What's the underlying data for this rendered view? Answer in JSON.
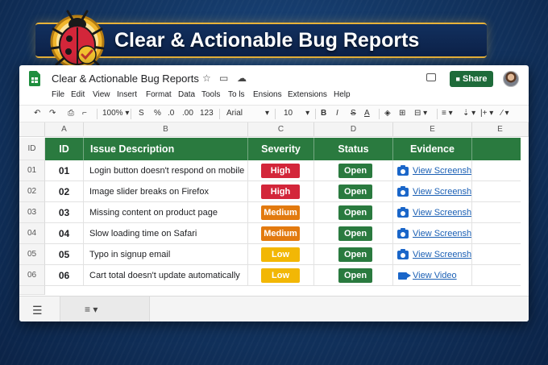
{
  "banner": {
    "title": "Clear & Actionable Bug Reports"
  },
  "app": {
    "doc_title": "Clear & Actionable Bug Reports",
    "share_label": "Share",
    "menu": [
      "File",
      "Edit",
      "View",
      "Insert",
      "Format",
      "Data",
      "Tools",
      "To ls",
      "Ensions",
      "Extensions",
      "Help"
    ],
    "toolbar": {
      "zoom": "100%",
      "currency": "S",
      "percent": "%",
      "dec_less": ".0",
      "dec_more": ".00",
      "number_format": "123",
      "font": "Arial",
      "font_size": "10",
      "bold": "B",
      "italic": "I",
      "strike": "S"
    }
  },
  "columns": [
    "A",
    "B",
    "C",
    "D",
    "E",
    "E"
  ],
  "header_row_label": "ID",
  "headers": {
    "id": "ID",
    "desc": "Issue Description",
    "severity": "Severity",
    "status": "Status",
    "evidence": "Evidence"
  },
  "rows": [
    {
      "num": "01",
      "id": "01",
      "desc": "Login button doesn't respond on mobile",
      "severity": "High",
      "status": "Open",
      "evidence": "View Screenshot",
      "evidence_icon": "camera-icon"
    },
    {
      "num": "02",
      "id": "02",
      "desc": "Image slider breaks on Firefox",
      "severity": "High",
      "status": "Open",
      "evidence": "View Screenshot",
      "evidence_icon": "camera-icon"
    },
    {
      "num": "03",
      "id": "03",
      "desc": "Missing content on product page",
      "severity": "Medium",
      "status": "Open",
      "evidence": "View Screenshot",
      "evidence_icon": "camera-icon"
    },
    {
      "num": "04",
      "id": "04",
      "desc": "Slow loading time on Safari",
      "severity": "Medium",
      "status": "Open",
      "evidence": "View Screenshot",
      "evidence_icon": "camera-icon"
    },
    {
      "num": "05",
      "id": "05",
      "desc": "Typo in signup email",
      "severity": "Low",
      "status": "Open",
      "evidence": "View Screenshot",
      "evidence_icon": "camera-icon"
    },
    {
      "num": "06",
      "id": "06",
      "desc": "Cart total doesn't update automatically",
      "severity": "Low",
      "status": "Open",
      "evidence": "View Video",
      "evidence_icon": "video-icon"
    }
  ],
  "colors": {
    "header_green": "#2a7a3f",
    "status_green": "#2a7a3f",
    "high": "#d3263a",
    "medium": "#e27a0f",
    "low": "#f2b705",
    "link": "#1a5fb4"
  }
}
